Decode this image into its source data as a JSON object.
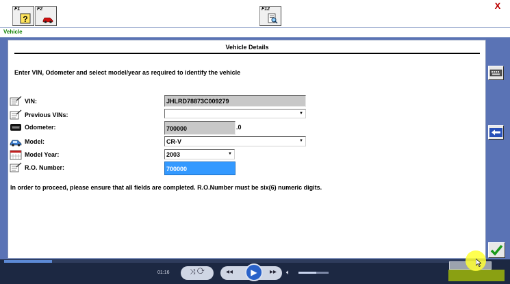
{
  "toolbar": {
    "buttons": [
      {
        "key": "F1",
        "icon": "help-icon"
      },
      {
        "key": "F2",
        "icon": "car-icon"
      },
      {
        "key": "F12",
        "icon": "print-preview-icon"
      }
    ],
    "close_label": "X"
  },
  "section": {
    "label": "Vehicle"
  },
  "panel": {
    "title": "Vehicle Details",
    "instruction": "Enter VIN, Odometer and select model/year as required to identify the vehicle",
    "fields": {
      "vin": {
        "label": "VIN:",
        "value": "JHLRD78873C009279",
        "icon": "checklist-icon"
      },
      "previous_vins": {
        "label": "Previous VINs:",
        "value": "",
        "icon": "checklist-icon"
      },
      "odometer": {
        "label": "Odometer:",
        "value": "700000",
        "suffix": ".0",
        "icon": "odometer-icon"
      },
      "model": {
        "label": "Model:",
        "value": "CR-V",
        "icon": "car-icon"
      },
      "model_year": {
        "label": "Model Year:",
        "value": "2003",
        "icon": "calendar-icon"
      },
      "ro_number": {
        "label": "R.O. Number:",
        "value": "700000",
        "icon": "checklist-icon"
      }
    },
    "notice": "In order to proceed, please ensure that all fields are completed. R.O.Number must be six(6) numeric digits."
  },
  "side_buttons": [
    {
      "icon": "keyboard-icon"
    },
    {
      "icon": "back-arrow-icon"
    },
    {
      "icon": "checkmark-icon"
    }
  ],
  "media": {
    "timecode": "01:16",
    "progress": 0.1,
    "volume": 0.6
  },
  "colors": {
    "background": "#5a73b5",
    "section_label": "#108000",
    "highlight_field": "#3399ff",
    "ok_check": "#1a9a1a"
  }
}
